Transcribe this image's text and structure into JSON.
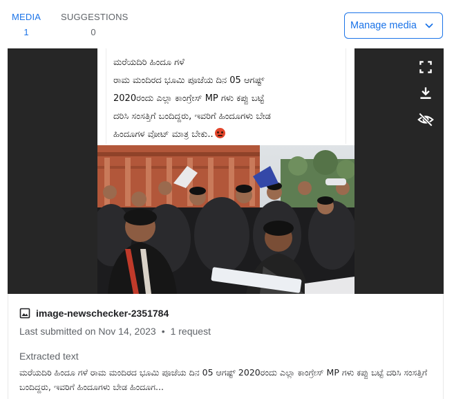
{
  "tabs": [
    {
      "label": "MEDIA",
      "count": "1"
    },
    {
      "label": "SUGGESTIONS",
      "count": "0"
    }
  ],
  "manage_button": {
    "label": "Manage media",
    "icon": "chevron-down-icon"
  },
  "viewer": {
    "caption_lines": [
      "ಮರೆಯದಿರಿ ಹಿಂದೂ ಗಳೆ",
      "ರಾಮ ಮಂದಿರದ ಭೂಮಿ ಪೂಜೆಯ ದಿನ 05 ಆಗಷ್ಟ್",
      "2020ರಂದು ಎಲ್ಲಾ ಕಾಂಗ್ರೇಸ್ MP ಗಳು ಕಪ್ಪು ಬಟ್ಟೆ",
      "ದರಿಸಿ ಸಂಸತ್ತಿಗೆ ಬಂದಿದ್ದರು, ಇವರಿಗೆ ಹಿಂದೂಗಳು ಬೇಡ",
      "ಹಿಂದೂಗಳ ವೋಟ್ ಮಾತ್ರ ಬೇಕು.."
    ],
    "tools": [
      "fullscreen-icon",
      "download-icon",
      "visibility-off-icon"
    ]
  },
  "media_item": {
    "file_icon": "image-icon",
    "file_name": "image-newschecker-2351784",
    "submitted": "Last submitted on Nov 14, 2023",
    "separator": "•",
    "requests": "1 request",
    "extracted_label": "Extracted text",
    "extracted_text": "ಮರೆಯದಿರಿ ಹಿಂದೂ ಗಳೆ ರಾಮ ಮಂದಿರದ ಭೂಮಿ ಪೂಜೆಯ ದಿನ 05 ಆಗಷ್ಟ್ 2020ರಂದು ಎಲ್ಲಾ ಕಾಂಗ್ರೇಸ್ MP ಗಳು ಕಪ್ಪು ಬಟ್ಟೆ ದರಿಸಿ ಸಂಸತ್ತಿಗೆ ಬಂದಿದ್ದರು, ಇವರಿಗೆ ಹಿಂದೂಗಳು ಬೇಡ ಹಿಂದೂಗ..."
  },
  "colors": {
    "accent": "#1a73e8",
    "viewer_bg": "#262626",
    "muted": "#5f6368"
  }
}
